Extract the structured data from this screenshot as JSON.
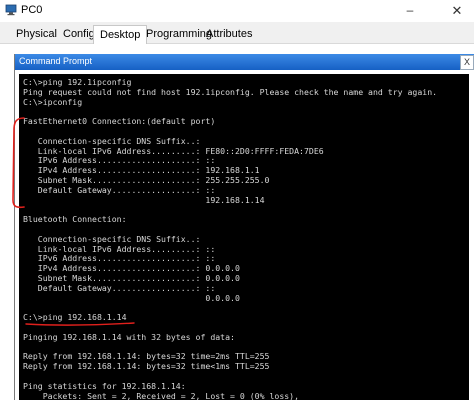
{
  "window": {
    "title": "PC0",
    "minimize_glyph": "–",
    "close_glyph": "✕"
  },
  "tabs": [
    {
      "label": "Physical"
    },
    {
      "label": "Config"
    },
    {
      "label": "Desktop",
      "active": true
    },
    {
      "label": "Programming"
    },
    {
      "label": "Attributes"
    }
  ],
  "command_prompt": {
    "title": "Command Prompt",
    "close_glyph": "X",
    "lines": [
      "C:\\>ping 192.1ipconfig",
      "Ping request could not find host 192.1ipconfig. Please check the name and try again.",
      "C:\\>ipconfig",
      "",
      "FastEthernet0 Connection:(default port)",
      "",
      "   Connection-specific DNS Suffix..:",
      "   Link-local IPv6 Address.........: FE80::2D0:FFFF:FEDA:7DE6",
      "   IPv6 Address....................: ::",
      "   IPv4 Address....................: 192.168.1.1",
      "   Subnet Mask.....................: 255.255.255.0",
      "   Default Gateway.................: ::",
      "                                     192.168.1.14",
      "",
      "Bluetooth Connection:",
      "",
      "   Connection-specific DNS Suffix..:",
      "   Link-local IPv6 Address.........: ::",
      "   IPv6 Address....................: ::",
      "   IPv4 Address....................: 0.0.0.0",
      "   Subnet Mask.....................: 0.0.0.0",
      "   Default Gateway.................: ::",
      "                                     0.0.0.0",
      "",
      "C:\\>ping 192.168.1.14",
      "",
      "Pinging 192.168.1.14 with 32 bytes of data:",
      "",
      "Reply from 192.168.1.14: bytes=32 time=2ms TTL=255",
      "Reply from 192.168.1.14: bytes=32 time<1ms TTL=255",
      "",
      "Ping statistics for 192.168.1.14:",
      "    Packets: Sent = 2, Received = 2, Lost = 0 (0% loss),"
    ]
  },
  "colors": {
    "annotation": "#e0201c",
    "cmd_title_bg": "#1660c4",
    "terminal_bg": "#000000",
    "terminal_text": "#d8d8d8"
  }
}
